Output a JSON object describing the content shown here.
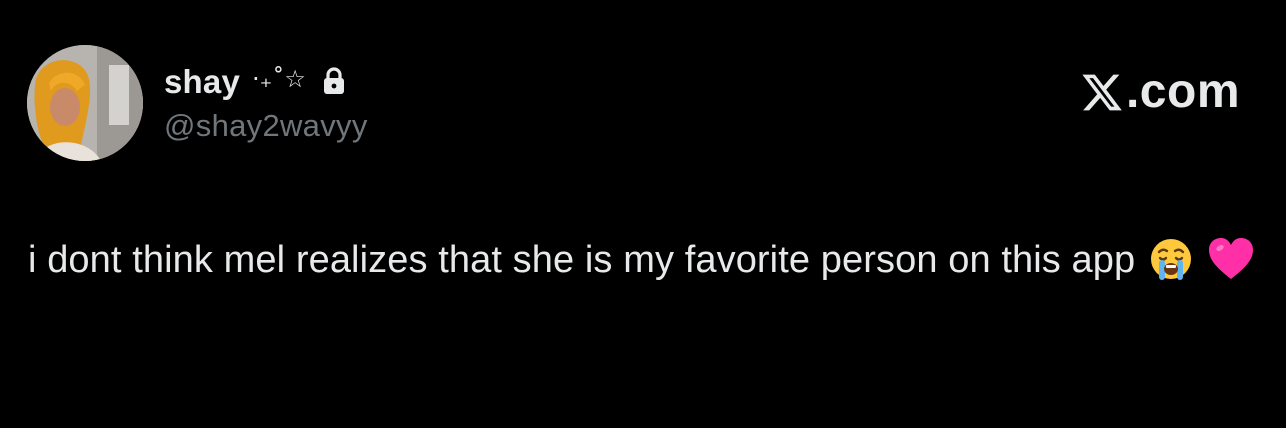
{
  "profile": {
    "display_name": "shay",
    "name_decoration": "·₊˚☆",
    "handle": "@shay2wavyy",
    "protected_icon": "lock-icon"
  },
  "brand": {
    "logo_icon": "x-logo-icon",
    "text": ".com"
  },
  "tweet": {
    "text": "i dont think mel realizes that she is my favorite person on this app",
    "emojis": [
      "loudly-crying-face-emoji",
      "pink-heart-emoji"
    ]
  },
  "colors": {
    "background": "#000000",
    "primary_text": "#e7e9ea",
    "secondary_text": "#71767b",
    "heart": "#ff2fa8",
    "emoji_face": "#ffc83d"
  }
}
